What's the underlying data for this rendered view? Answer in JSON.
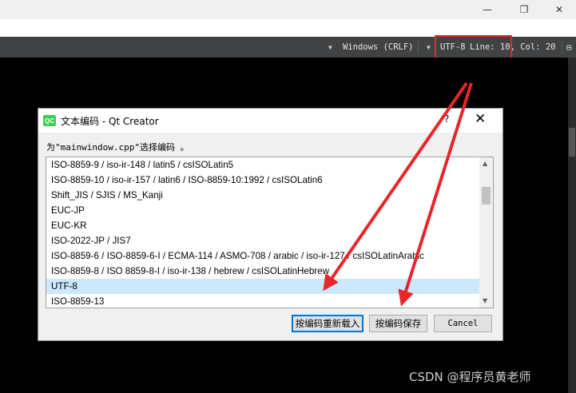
{
  "window": {
    "minimize": "—",
    "maximize": "❐",
    "close": "✕"
  },
  "statusbar": {
    "line_ending_arrow": "▼",
    "line_ending": "Windows (CRLF)",
    "encoding_arrow": "▼",
    "encoding": "UTF-8",
    "position": "Line: 10, Col: 20"
  },
  "dialog": {
    "title": "文本编码 - Qt Creator",
    "logo": "QC",
    "help": "?",
    "close": "✕",
    "prompt": "为\"mainwindow.cpp\"选择编码 。",
    "encodings": [
      "ISO-8859-9 / iso-ir-148 / latin5 / csISOLatin5",
      "ISO-8859-10 / iso-ir-157 / latin6 / ISO-8859-10:1992 / csISOLatin6",
      "Shift_JIS / SJIS / MS_Kanji",
      "EUC-JP",
      "EUC-KR",
      "ISO-2022-JP / JIS7",
      "ISO-8859-6 / ISO-8859-6-I / ECMA-114 / ASMO-708 / arabic / iso-ir-127 / csISOLatinArabic",
      "ISO-8859-8 / ISO 8859-8-I / iso-ir-138 / hebrew / csISOLatinHebrew",
      "UTF-8",
      "ISO-8859-13"
    ],
    "selected_index": 8,
    "scroll_up": "▲",
    "scroll_down": "▼",
    "buttons": {
      "reload": "按编码重新载入",
      "save": "按编码保存",
      "cancel": "Cancel"
    }
  },
  "watermark": "CSDN @程序员黄老师",
  "colors": {
    "highlight": "#e8262a",
    "arrow": "#e8262a",
    "selection": "#cce8ff"
  }
}
